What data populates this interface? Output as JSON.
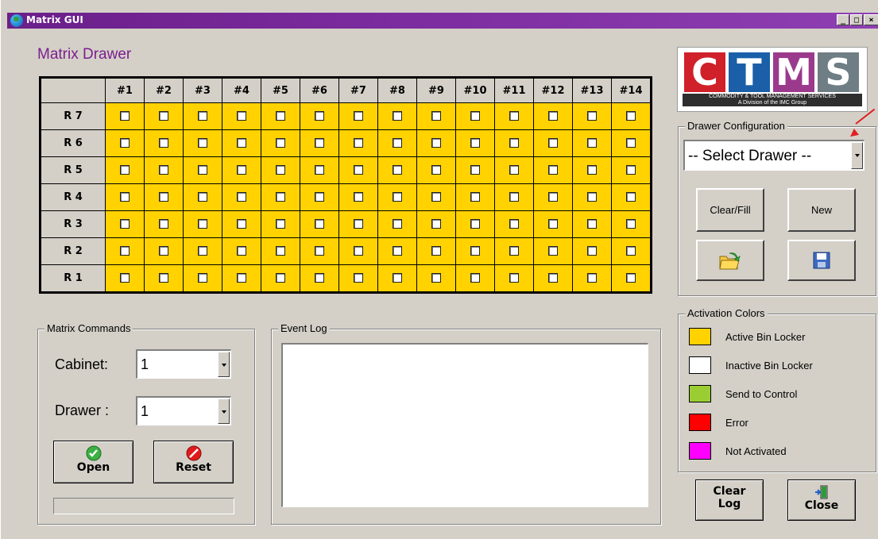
{
  "window": {
    "title": "Matrix GUI",
    "controls": [
      "_",
      "□",
      "×"
    ]
  },
  "page_title": "Matrix Drawer",
  "grid": {
    "columns": [
      "#1",
      "#2",
      "#3",
      "#4",
      "#5",
      "#6",
      "#7",
      "#8",
      "#9",
      "#10",
      "#11",
      "#12",
      "#13",
      "#14"
    ],
    "rows": [
      "R 7",
      "R 6",
      "R 5",
      "R 4",
      "R 3",
      "R 2",
      "R 1"
    ],
    "cell_color": "#ffd200"
  },
  "logo": {
    "letters": [
      "C",
      "T",
      "M",
      "S"
    ],
    "letter_colors": [
      "#d0202a",
      "#1a5fa8",
      "#9b3a8c",
      "#6f7d84"
    ],
    "tagline": "COMMODITY & TOOL MANAGEMENT SERVICES",
    "subline": "A Division of the IMC Group"
  },
  "drawer_config": {
    "legend": "Drawer Configuration",
    "select_value": "-- Select Drawer --",
    "clear_fill": "Clear/Fill",
    "new": "New"
  },
  "activation_colors": {
    "legend": "Activation Colors",
    "items": [
      {
        "label": "Active Bin Locker",
        "color": "#ffd200"
      },
      {
        "label": "Inactive Bin Locker",
        "color": "#ffffff"
      },
      {
        "label": "Send to Control",
        "color": "#9acd32"
      },
      {
        "label": "Error",
        "color": "#ff0000"
      },
      {
        "label": "Not Activated",
        "color": "#ff00ff"
      }
    ]
  },
  "matrix_commands": {
    "legend": "Matrix Commands",
    "cabinet_label": "Cabinet:",
    "cabinet_value": "1",
    "drawer_label": "Drawer :",
    "drawer_value": "1",
    "open": "Open",
    "reset": "Reset"
  },
  "event_log": {
    "legend": "Event Log"
  },
  "buttons": {
    "clear_log_1": "Clear",
    "clear_log_2": "Log",
    "close": "Close"
  }
}
